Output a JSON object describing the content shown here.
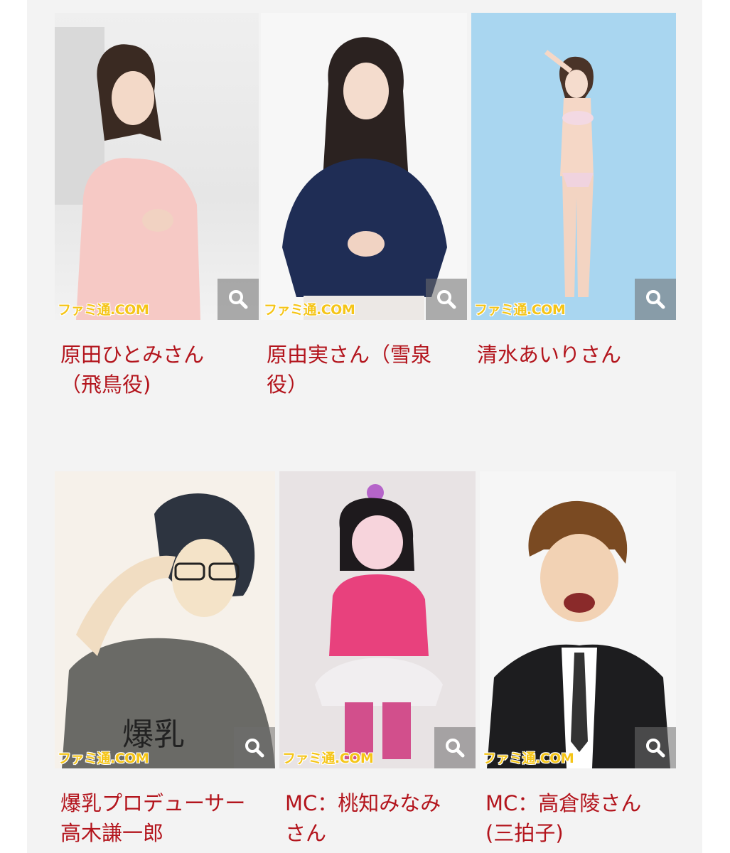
{
  "brand": {
    "watermark": "ファミ通.COM",
    "accent": "#b3141c",
    "background": "#f3f3f3"
  },
  "row1": [
    {
      "line1": "原田ひとみさん",
      "line2": "（飛鳥役)",
      "icon": "zoom-icon"
    },
    {
      "line1": "原由実さん（雪泉",
      "line2": "役）",
      "icon": "zoom-icon"
    },
    {
      "line1": "清水あいりさん",
      "line2": "",
      "icon": "zoom-icon"
    }
  ],
  "row2": [
    {
      "line1": "爆乳プロデューサー",
      "line2": "高木謙一郎",
      "icon": "zoom-icon"
    },
    {
      "line1": "MC：桃知みなみ",
      "line2": "さん",
      "icon": "zoom-icon"
    },
    {
      "line1": "MC：高倉陵さん",
      "line2": "(三拍子)",
      "icon": "zoom-icon"
    }
  ]
}
